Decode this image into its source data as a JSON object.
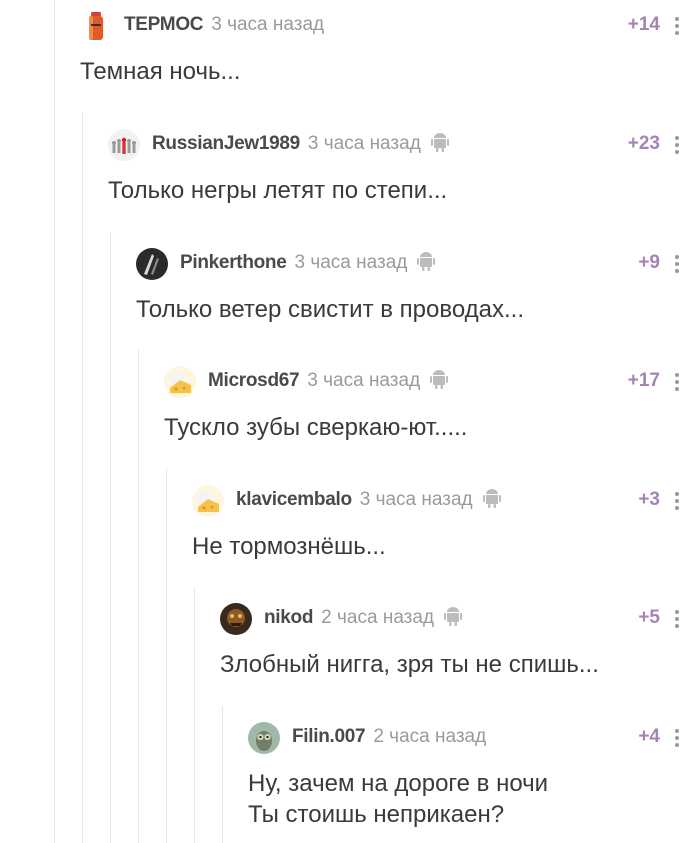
{
  "comments": [
    {
      "username": "ТЕРМОС",
      "time": "3 часа назад",
      "rating": "+14",
      "text": "Темная ночь...",
      "device_icon": false,
      "avatar_icon": "thermos-avatar-icon"
    },
    {
      "username": "RussianJew1989",
      "time": "3 часа назад",
      "rating": "+23",
      "text": "Только негры летят по степи...",
      "device_icon": true,
      "avatar_icon": "crowd-avatar-icon"
    },
    {
      "username": "Pinkerthone",
      "time": "3 часа назад",
      "rating": "+9",
      "text": "Только ветер свистит в проводах...",
      "device_icon": true,
      "avatar_icon": "dark-avatar-icon"
    },
    {
      "username": "Microsd67",
      "time": "3 часа назад",
      "rating": "+17",
      "text": "Тускло зубы сверкаю-ют.....",
      "device_icon": true,
      "avatar_icon": "cheese-avatar-icon"
    },
    {
      "username": "klavicembalo",
      "time": "3 часа назад",
      "rating": "+3",
      "text": "Не тормознёшь...",
      "device_icon": true,
      "avatar_icon": "cheese-avatar-icon"
    },
    {
      "username": "nikod",
      "time": "2 часа назад",
      "rating": "+5",
      "text": "Злобный нигга, зря ты не спишь...",
      "device_icon": true,
      "avatar_icon": "monster-avatar-icon"
    },
    {
      "username": "Filin.007",
      "time": "2 часа назад",
      "rating": "+4",
      "text": "Ну, зачем на дороге в ночи\nТы стоишь неприкаен?",
      "device_icon": false,
      "avatar_icon": "owl-avatar-icon"
    }
  ]
}
